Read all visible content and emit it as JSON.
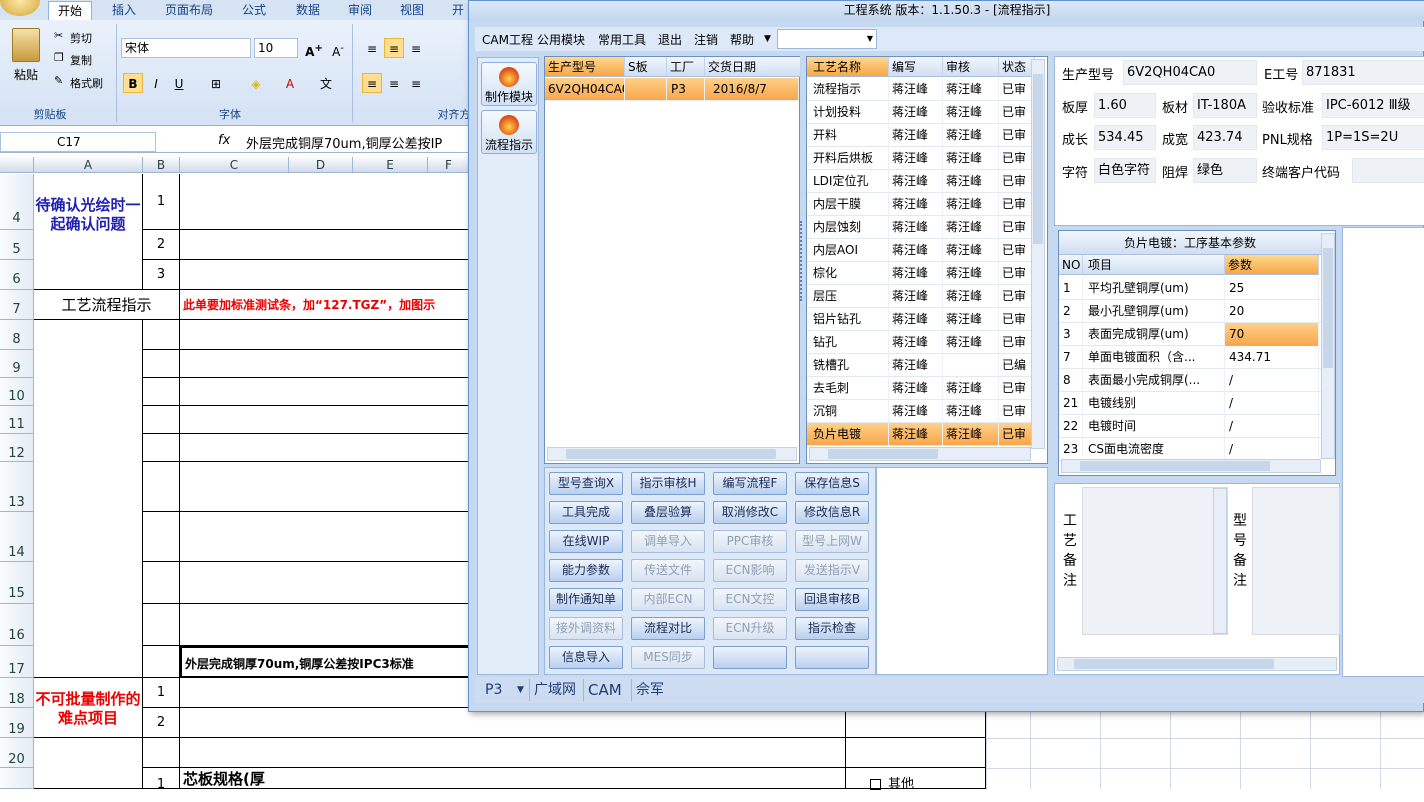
{
  "excel": {
    "tabs": [
      "开始",
      "插入",
      "页面布局",
      "公式",
      "数据",
      "审阅",
      "视图",
      "开"
    ],
    "clipboard": {
      "paste": "粘贴",
      "cut": "剪切",
      "copy": "复制",
      "format_painter": "格式刷",
      "group": "剪贴板"
    },
    "font": {
      "name": "宋体",
      "size": "10",
      "group": "字体"
    },
    "align_group": "对齐方",
    "name_box": "C17",
    "formula": "外层完成铜厚70um,铜厚公差按IP",
    "columns": [
      "A",
      "B",
      "C",
      "D",
      "E",
      "F"
    ],
    "rows": [
      "4",
      "5",
      "6",
      "7",
      "8",
      "9",
      "10",
      "11",
      "12",
      "13",
      "14",
      "15",
      "16",
      "17",
      "18",
      "19",
      "20"
    ],
    "cells": {
      "a4": "待确认光绘时一起确认问题",
      "b4": "1",
      "b5": "2",
      "b6": "3",
      "a7": "工艺流程指示",
      "c7": "此单要加标准测试条，加“127.TGZ”，加图示",
      "c17": "外层完成铜厚70um,铜厚公差按IPC3标准",
      "a18": "不可批量制作的难点项目",
      "b18": "1",
      "b19": "2",
      "b21": "1",
      "c21": "芯板规格(厚",
      "f21": "其他"
    }
  },
  "app": {
    "title": "工程系统  版本：1.1.50.3 - [流程指示]",
    "menu": [
      "CAM工程",
      "公用模块",
      "常用工具",
      "退出",
      "注销",
      "帮助"
    ],
    "nav": [
      "制作模块",
      "流程指示"
    ],
    "orders": {
      "headers": [
        "生产型号",
        "S板",
        "工厂",
        "交货日期"
      ],
      "rows": [
        [
          "6V2QH04CA0",
          "",
          "P3",
          "2016/8/7"
        ]
      ]
    },
    "processes": {
      "headers": [
        "工艺名称",
        "编写",
        "审核",
        "状态"
      ],
      "rows": [
        [
          "流程指示",
          "蒋汪峰",
          "蒋汪峰",
          "已审"
        ],
        [
          "计划投料",
          "蒋汪峰",
          "蒋汪峰",
          "已审"
        ],
        [
          "开料",
          "蒋汪峰",
          "蒋汪峰",
          "已审"
        ],
        [
          "开料后烘板",
          "蒋汪峰",
          "蒋汪峰",
          "已审"
        ],
        [
          "LDI定位孔",
          "蒋汪峰",
          "蒋汪峰",
          "已审"
        ],
        [
          "内层干膜",
          "蒋汪峰",
          "蒋汪峰",
          "已审"
        ],
        [
          "内层蚀刻",
          "蒋汪峰",
          "蒋汪峰",
          "已审"
        ],
        [
          "内层AOI",
          "蒋汪峰",
          "蒋汪峰",
          "已审"
        ],
        [
          "棕化",
          "蒋汪峰",
          "蒋汪峰",
          "已审"
        ],
        [
          "层压",
          "蒋汪峰",
          "蒋汪峰",
          "已审"
        ],
        [
          "铝片钻孔",
          "蒋汪峰",
          "蒋汪峰",
          "已审"
        ],
        [
          "钻孔",
          "蒋汪峰",
          "蒋汪峰",
          "已审"
        ],
        [
          "铣槽孔",
          "蒋汪峰",
          "",
          "已编"
        ],
        [
          "去毛刺",
          "蒋汪峰",
          "蒋汪峰",
          "已审"
        ],
        [
          "沉铜",
          "蒋汪峰",
          "蒋汪峰",
          "已审"
        ],
        [
          "负片电镀",
          "蒋汪峰",
          "蒋汪峰",
          "已审"
        ]
      ]
    },
    "buttons": [
      [
        "型号查询X",
        "指示审核H",
        "编写流程F",
        "保存信息S"
      ],
      [
        "工具完成",
        "叠层验算",
        "取消修改C",
        "修改信息R"
      ],
      [
        "在线WIP",
        "调单导入",
        "PPC审核",
        "型号上网W"
      ],
      [
        "能力参数",
        "传送文件",
        "ECN影响",
        "发送指示V"
      ],
      [
        "制作通知单",
        "内部ECN",
        "ECN文控",
        "回退审核B"
      ],
      [
        "接外调资料",
        "流程对比",
        "ECN升级",
        "指示检查"
      ],
      [
        "信息导入",
        "MES同步",
        "",
        ""
      ]
    ],
    "info": {
      "model_label": "生产型号",
      "model": "6V2QH04CA0",
      "eno_label": "E工号",
      "eno": "871831",
      "thick_label": "板厚",
      "thick": "1.60",
      "mat_label": "板材",
      "mat": "IT-180A",
      "std_label": "验收标准",
      "std": "IPC-6012 Ⅲ级",
      "len_label": "成长",
      "len": "534.45",
      "wid_label": "成宽",
      "wid": "423.74",
      "pnl_label": "PNL规格",
      "pnl": "1P=1S=2U",
      "char_label": "字符",
      "char": "白色字符",
      "mask_label": "阻焊",
      "mask": "绿色",
      "cust_label": "终端客户代码",
      "cust": ""
    },
    "params": {
      "title": "负片电镀：工序基本参数",
      "headers": [
        "NO",
        "项目",
        "参数"
      ],
      "rows": [
        [
          "1",
          "平均孔壁铜厚(um)",
          "25"
        ],
        [
          "2",
          "最小孔壁铜厚(um)",
          "20"
        ],
        [
          "3",
          "表面完成铜厚(um)",
          "70"
        ],
        [
          "7",
          "单面电镀面积（含...",
          "434.71"
        ],
        [
          "8",
          "表面最小完成铜厚(...",
          "/"
        ],
        [
          "21",
          "电镀线别",
          "/"
        ],
        [
          "22",
          "电镀时间",
          "/"
        ],
        [
          "23",
          "CS面电流密度",
          "/"
        ]
      ]
    },
    "notes": {
      "process": "工艺备注",
      "model": "型号备注"
    },
    "status": {
      "site": "P3",
      "tabs": [
        "广域网",
        "CAM",
        "佘军"
      ]
    }
  }
}
